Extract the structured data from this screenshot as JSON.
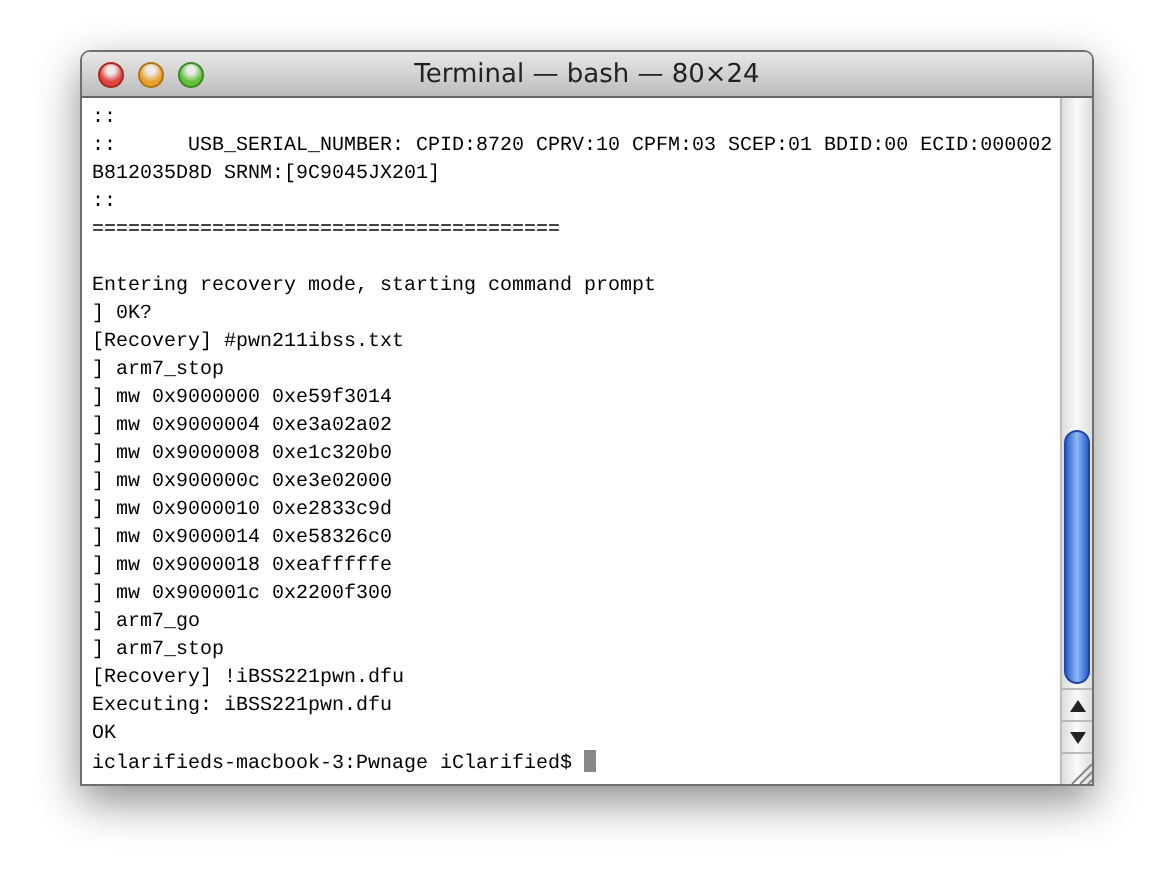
{
  "window": {
    "title": "Terminal — bash — 80×24"
  },
  "terminal": {
    "lines": [
      {
        "kind": "text",
        "text": "::"
      },
      {
        "kind": "text",
        "text": "::      USB_SERIAL_NUMBER: CPID:8720 CPRV:10 CPFM:03 SCEP:01 BDID:00 ECID:000002"
      },
      {
        "kind": "text",
        "text": "B812035D8D SRNM:[9C9045JX201]"
      },
      {
        "kind": "text",
        "text": "::"
      },
      {
        "kind": "text",
        "text": "======================================="
      },
      {
        "kind": "blank"
      },
      {
        "kind": "text",
        "text": "Entering recovery mode, starting command prompt"
      },
      {
        "kind": "text",
        "text": "] 0K?"
      },
      {
        "kind": "text",
        "text": "[Recovery] #pwn211ibss.txt"
      },
      {
        "kind": "text",
        "text": "] arm7_stop"
      },
      {
        "kind": "text",
        "text": "] mw 0x9000000 0xe59f3014"
      },
      {
        "kind": "text",
        "text": "] mw 0x9000004 0xe3a02a02"
      },
      {
        "kind": "text",
        "text": "] mw 0x9000008 0xe1c320b0"
      },
      {
        "kind": "text",
        "text": "] mw 0x900000c 0xe3e02000"
      },
      {
        "kind": "text",
        "text": "] mw 0x9000010 0xe2833c9d"
      },
      {
        "kind": "text",
        "text": "] mw 0x9000014 0xe58326c0"
      },
      {
        "kind": "text",
        "text": "] mw 0x9000018 0xeafffffe"
      },
      {
        "kind": "text",
        "text": "] mw 0x900001c 0x2200f300"
      },
      {
        "kind": "text",
        "text": "] arm7_go"
      },
      {
        "kind": "text",
        "text": "] arm7_stop"
      },
      {
        "kind": "text",
        "text": "[Recovery] !iBSS221pwn.dfu"
      },
      {
        "kind": "text",
        "text": "Executing: iBSS221pwn.dfu"
      },
      {
        "kind": "text",
        "text": "OK"
      }
    ],
    "prompt": "iclarifieds-macbook-3:Pwnage iClarified$"
  }
}
